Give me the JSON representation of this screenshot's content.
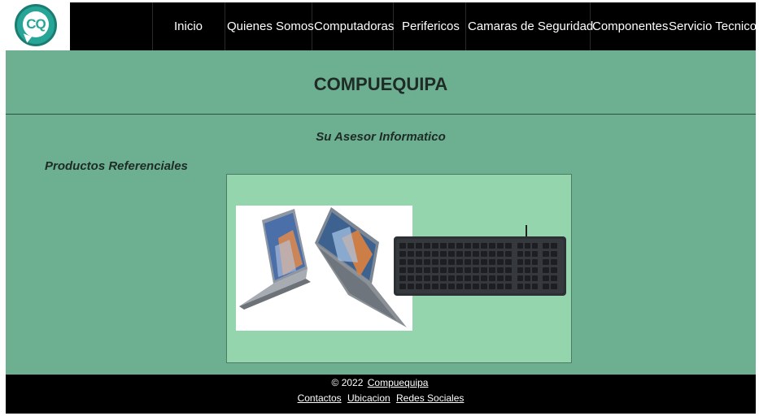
{
  "nav": {
    "logo_text": "CQ",
    "items": [
      {
        "label": "Inicio"
      },
      {
        "label": "Quienes Somos"
      },
      {
        "label": "Computadoras"
      },
      {
        "label": "Perifericos"
      },
      {
        "label": "Camaras de Seguridad"
      },
      {
        "label": "Componentes"
      },
      {
        "label": "Servicio Tecnico"
      }
    ]
  },
  "header": {
    "title": "COMPUEQUIPA",
    "tagline": "Su Asesor Informatico"
  },
  "products": {
    "section_title": "Productos Referenciales",
    "images": [
      "laptop-image",
      "keyboard-image"
    ]
  },
  "footer": {
    "copyright": "© 2022",
    "brand_link": "Compuequipa",
    "links": [
      {
        "label": "Contactos"
      },
      {
        "label": "Ubicacion"
      },
      {
        "label": "Redes Sociales"
      }
    ]
  },
  "colors": {
    "page_bg": "#6daf91",
    "panel_bg": "#95d5ad",
    "nav_bg": "#000000",
    "logo_accent": "#27a596"
  }
}
